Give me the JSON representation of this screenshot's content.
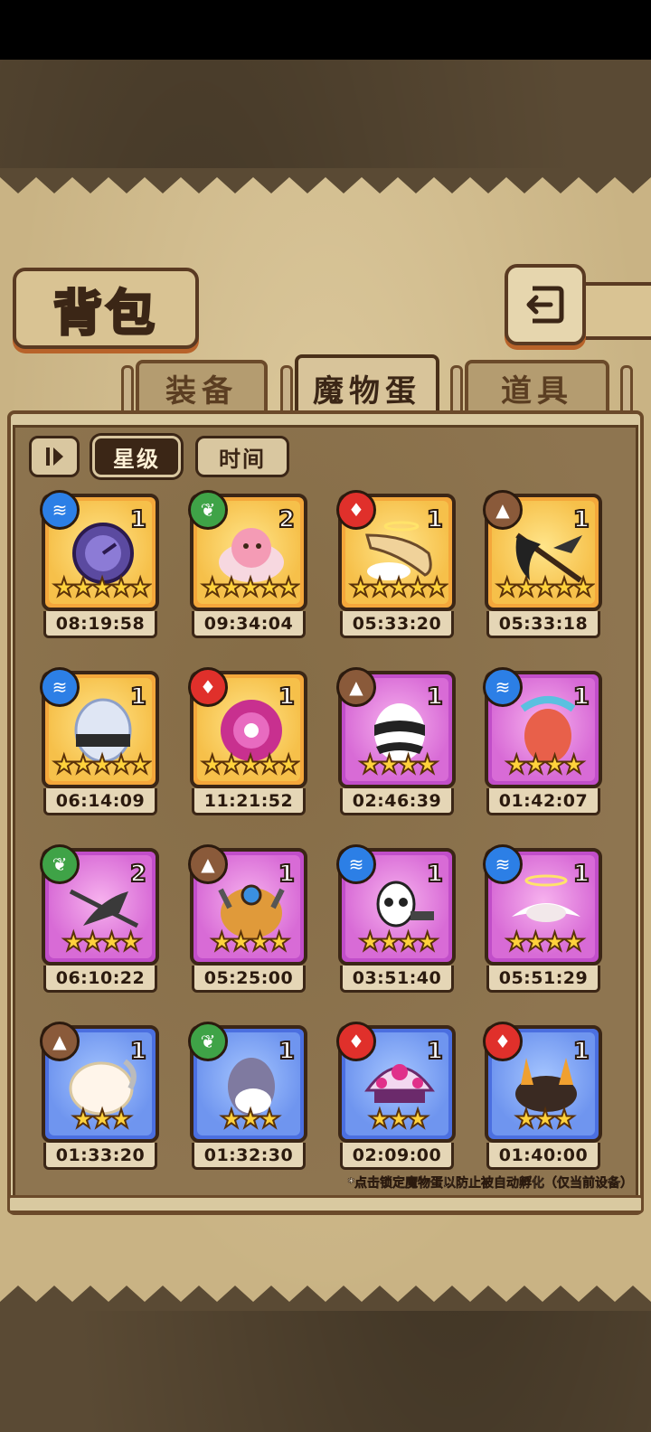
{
  "title": "背包",
  "tabs": [
    {
      "label": "装备",
      "active": false
    },
    {
      "label": "魔物蛋",
      "active": true
    },
    {
      "label": "道具",
      "active": false
    }
  ],
  "sort": {
    "toggle_icon": "sort-toggle-icon",
    "star_label": "星级",
    "time_label": "时间",
    "active": "星级"
  },
  "colors": {
    "gold": "#f4a73b",
    "purple": "#c14ec9",
    "blue": "#4b6fe0",
    "water": "#2c7fe6",
    "earth": "#8a5a3a",
    "fire": "#e0302b",
    "nature": "#3fa347"
  },
  "eggs": [
    {
      "element": "water",
      "count": "1",
      "stars": 5,
      "rarity": "gold",
      "timer": "08:19:58",
      "art": "pocket-watch"
    },
    {
      "element": "nature",
      "count": "2",
      "stars": 5,
      "rarity": "gold",
      "timer": "09:34:04",
      "art": "pink-creature"
    },
    {
      "element": "fire",
      "count": "1",
      "stars": 5,
      "rarity": "gold",
      "timer": "05:33:20",
      "art": "horn"
    },
    {
      "element": "earth",
      "count": "1",
      "stars": 5,
      "rarity": "gold",
      "timer": "05:33:18",
      "art": "scythe"
    },
    {
      "element": "water",
      "count": "1",
      "stars": 5,
      "rarity": "gold",
      "timer": "06:14:09",
      "art": "crystal-egg"
    },
    {
      "element": "fire",
      "count": "1",
      "stars": 5,
      "rarity": "gold",
      "timer": "11:21:52",
      "art": "pink-orb"
    },
    {
      "element": "earth",
      "count": "1",
      "stars": 4,
      "rarity": "purple",
      "timer": "02:46:39",
      "art": "striped-egg"
    },
    {
      "element": "water",
      "count": "1",
      "stars": 4,
      "rarity": "purple",
      "timer": "01:42:07",
      "art": "feather-egg"
    },
    {
      "element": "nature",
      "count": "2",
      "stars": 4,
      "rarity": "purple",
      "timer": "06:10:22",
      "art": "trident"
    },
    {
      "element": "earth",
      "count": "1",
      "stars": 4,
      "rarity": "purple",
      "timer": "05:25:00",
      "art": "fur-egg"
    },
    {
      "element": "water",
      "count": "1",
      "stars": 4,
      "rarity": "purple",
      "timer": "03:51:40",
      "art": "skull-bunny"
    },
    {
      "element": "water",
      "count": "1",
      "stars": 4,
      "rarity": "purple",
      "timer": "05:51:29",
      "art": "wings-halo"
    },
    {
      "element": "earth",
      "count": "1",
      "stars": 3,
      "rarity": "blue",
      "timer": "01:33:20",
      "art": "fluffy-egg"
    },
    {
      "element": "nature",
      "count": "1",
      "stars": 3,
      "rarity": "blue",
      "timer": "01:32:30",
      "art": "plain-egg"
    },
    {
      "element": "fire",
      "count": "1",
      "stars": 3,
      "rarity": "blue",
      "timer": "02:09:00",
      "art": "mushroom"
    },
    {
      "element": "fire",
      "count": "1",
      "stars": 3,
      "rarity": "blue",
      "timer": "01:40:00",
      "art": "flame-fur"
    }
  ],
  "footnote": "*点击锁定魔物蛋以防止被自动孵化（仅当前设备）"
}
